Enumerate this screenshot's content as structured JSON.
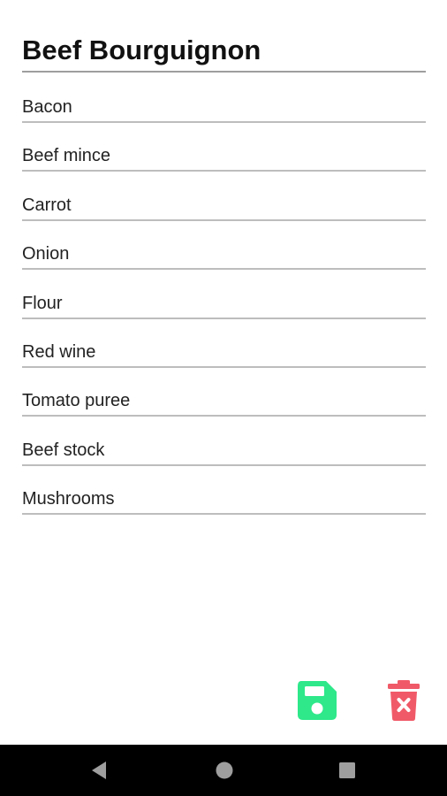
{
  "recipe": {
    "title": "Beef Bourguignon",
    "ingredients": [
      "Bacon",
      "Beef mince",
      "Carrot",
      "Onion",
      "Flour",
      "Red wine",
      "Tomato puree",
      "Beef stock",
      "Mushrooms"
    ]
  },
  "actions": {
    "save_icon": "floppy-disk-icon",
    "save_color": "#2ee88a",
    "delete_icon": "trash-x-icon",
    "delete_color": "#f05a68"
  },
  "navigation": {
    "back_icon": "triangle-back-icon",
    "home_icon": "circle-home-icon",
    "recents_icon": "square-recents-icon",
    "bar_color": "#000000"
  }
}
